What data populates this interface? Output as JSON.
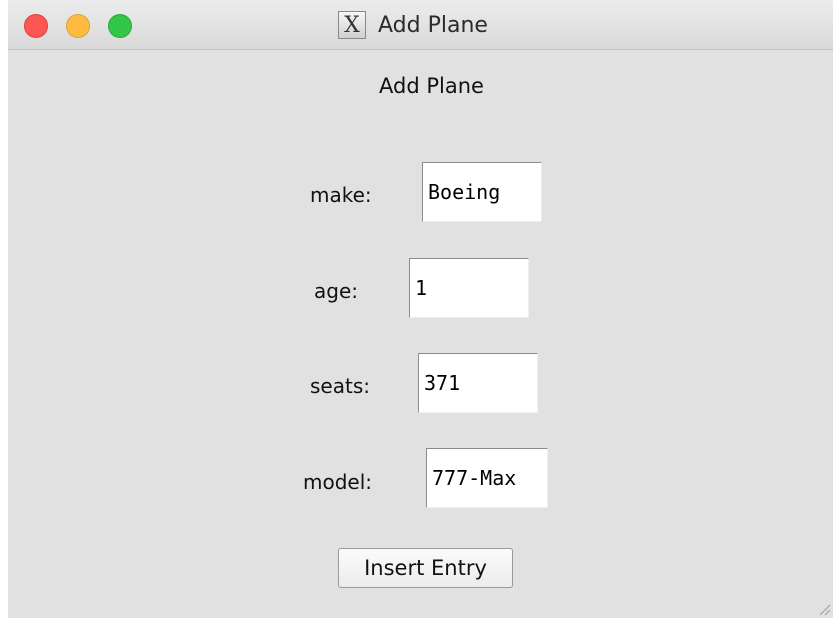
{
  "window": {
    "title": "Add Plane",
    "title_icon": "x11-icon",
    "title_icon_glyph": "X"
  },
  "form": {
    "heading": "Add Plane",
    "fields": [
      {
        "label": "make:",
        "value": "Boeing"
      },
      {
        "label": "age:",
        "value": "1"
      },
      {
        "label": "seats:",
        "value": "371"
      },
      {
        "label": "model:",
        "value": "777-Max"
      }
    ],
    "submit_label": "Insert Entry"
  },
  "colors": {
    "close": "#fc5753",
    "minimize": "#fdbc40",
    "maximize": "#33c748",
    "background": "#e1e1e1"
  }
}
